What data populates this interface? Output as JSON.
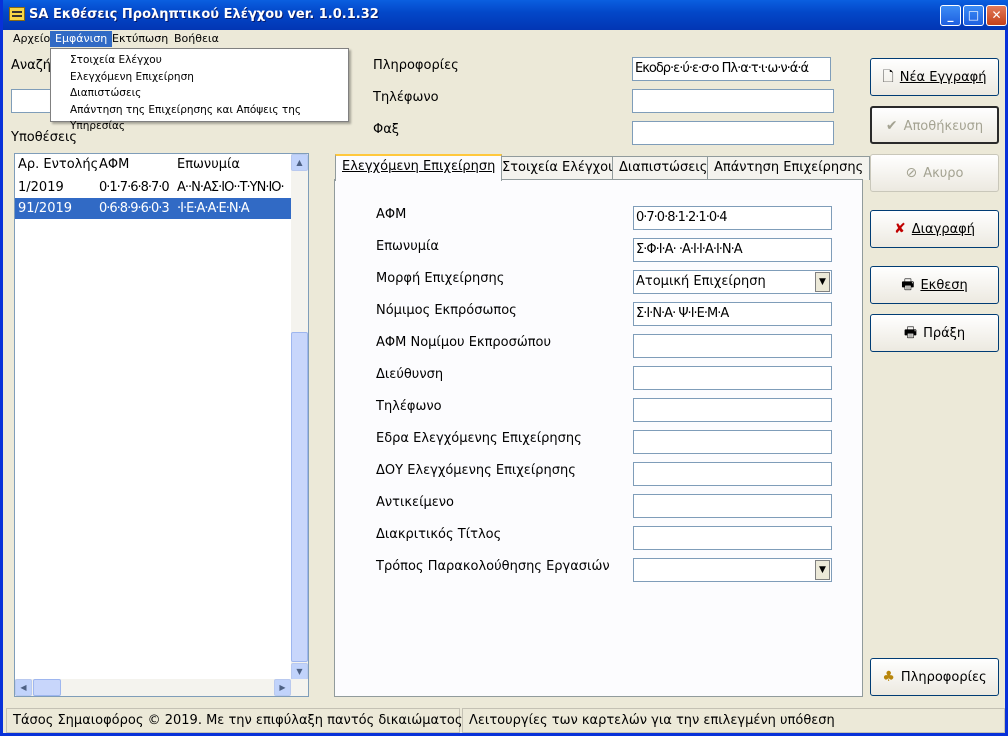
{
  "window": {
    "title": "SA Εκθέσεις Προληπτικού Ελέγχου ver. 1.0.1.32"
  },
  "menu": {
    "items": [
      "Αρχείο",
      "Εμφάνιση",
      "Εκτύπωση",
      "Βοήθεια"
    ],
    "dropdown": [
      "Στοιχεία Ελέγχου",
      "Ελεγχόμενη Επιχείρηση",
      "Διαπιστώσεις",
      "Απάντηση της Επιχείρησης και Απόψεις της Υπηρεσίας"
    ]
  },
  "search": {
    "label": "Αναζήτ",
    "value": ""
  },
  "cases": {
    "label": "Υποθέσεις",
    "headers": [
      "Αρ. Εντολής",
      "ΑΦΜ",
      "Επωνυμία"
    ],
    "rows": [
      {
        "order": "1/2019",
        "afm": "0·1·7·6·8·7·0",
        "name": "Α··Ν·ΑΣ·ΙΟ··Τ·ΥΝ·ΙΟ·"
      },
      {
        "order": "91/2019",
        "afm": "0·6·8·9·6·0·3",
        "name": "·Ι·Ε·Α·Α·Ε·Ν·Α"
      }
    ]
  },
  "info": {
    "pliroforias_label": "Πληροφορίες",
    "pliroforias_value": "Εκοδρ·ε·ύ·ε·σ·ο Πλ·α·τ·ι·ω·ν·ά·ά",
    "tilefono_label": "Τηλέφωνο",
    "tilefono_value": "",
    "fax_label": "Φαξ",
    "fax_value": ""
  },
  "tabs": [
    "Ελεγχόμενη Επιχείρηση",
    "Στοιχεία Ελέγχου",
    "Διαπιστώσεις",
    "Απάντηση Επιχείρησης"
  ],
  "form": [
    {
      "label": "ΑΦΜ",
      "value": "0·7·0·8·1·2·1·0·4"
    },
    {
      "label": "Επωνυμία",
      "value": "Σ·Φ·Ι·Α· ·Α·Ι·Ι·Α·Ι·Ν·Α"
    },
    {
      "label": "Μορφή Επιχείρησης",
      "value": "Ατομική Επιχείρηση"
    },
    {
      "label": "Νόμιμος Εκπρόσωπος",
      "value": "Σ·Ι·Ν·Α· Ψ·Ι·Ε·Μ·Α"
    },
    {
      "label": "ΑΦΜ Νομίμου Εκπροσώπου",
      "value": ""
    },
    {
      "label": "Διεύθυνση",
      "value": ""
    },
    {
      "label": "Τηλέφωνο",
      "value": ""
    },
    {
      "label": "Εδρα Ελεγχόμενης Επιχείρησης",
      "value": ""
    },
    {
      "label": "ΔΟΥ Ελεγχόμενης Επιχείρησης",
      "value": ""
    },
    {
      "label": "Αντικείμενο",
      "value": ""
    },
    {
      "label": "Διακριτικός Τίτλος",
      "value": ""
    },
    {
      "label": "Τρόπος Παρακολούθησης Εργασιών",
      "value": ""
    }
  ],
  "buttons": {
    "new": "Νέα Εγγραφή",
    "save": "Αποθήκευση",
    "cancel": "Ακυρο",
    "delete": "Διαγραφή",
    "report": "Εκθεση",
    "act": "Πράξη",
    "info": "Πληροφορίες"
  },
  "status": {
    "left": "Τάσος Σημαιοφόρος © 2019. Με την επιφύλαξη παντός δικαιώματος",
    "right": "Λειτουργίες των καρτελών για την επιλεγμένη υπόθεση"
  }
}
